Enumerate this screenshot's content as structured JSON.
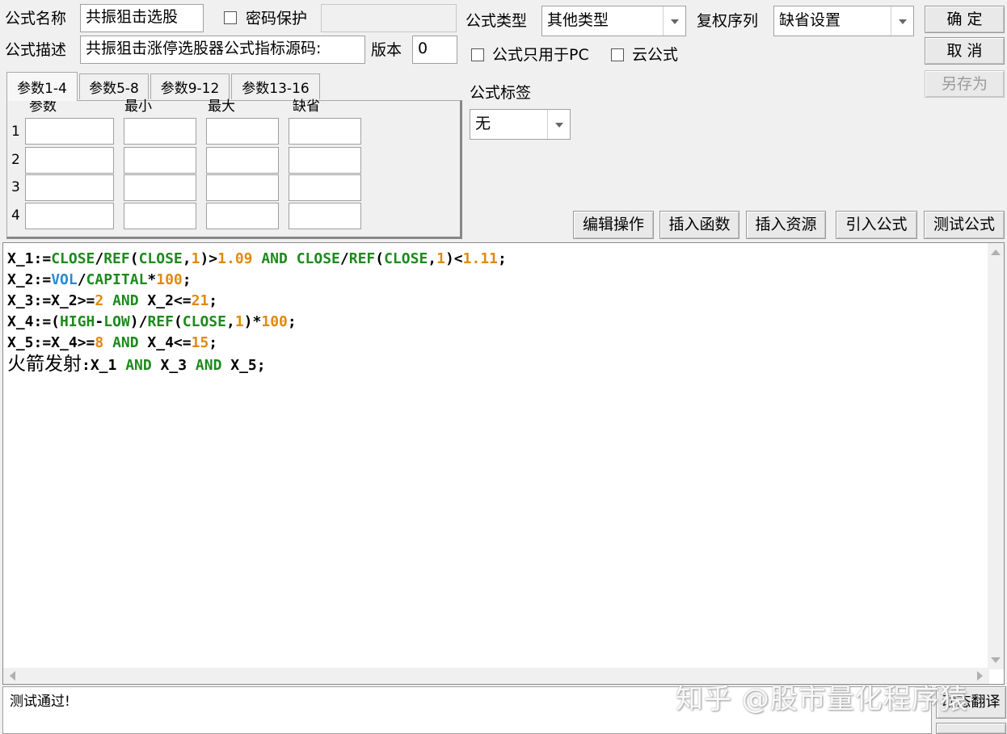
{
  "form": {
    "name_label": "公式名称",
    "name_value": "共振狙击选股",
    "password_label": "密码保护",
    "desc_label": "公式描述",
    "desc_value": "共振狙击涨停选股器公式指标源码:",
    "version_label": "版本",
    "version_value": "0",
    "type_label": "公式类型",
    "type_value": "其他类型",
    "rights_label": "复权序列",
    "rights_value": "缺省设置",
    "pc_only_label": "公式只用于PC",
    "cloud_label": "云公式",
    "tag_label": "公式标签",
    "tag_value": "无"
  },
  "buttons": {
    "confirm": "确 定",
    "cancel": "取 消",
    "save_as": "另存为",
    "edit_ops": "编辑操作",
    "insert_func": "插入函数",
    "insert_res": "插入资源",
    "import_formula": "引入公式",
    "test_formula": "测试公式",
    "dynamic_translate": "动态翻译"
  },
  "tabs": [
    "参数1-4",
    "参数5-8",
    "参数9-12",
    "参数13-16"
  ],
  "param_headers": [
    "参数",
    "最小",
    "最大",
    "缺省"
  ],
  "param_rows": [
    "1",
    "2",
    "3",
    "4"
  ],
  "code_lines": [
    [
      {
        "t": "X_1:=",
        "c": ""
      },
      {
        "t": "CLOSE",
        "c": "kw"
      },
      {
        "t": "/",
        "c": ""
      },
      {
        "t": "REF",
        "c": "kw"
      },
      {
        "t": "(",
        "c": ""
      },
      {
        "t": "CLOSE",
        "c": "kw"
      },
      {
        "t": ",",
        "c": ""
      },
      {
        "t": "1",
        "c": "num"
      },
      {
        "t": ")>",
        "c": ""
      },
      {
        "t": "1.09",
        "c": "num"
      },
      {
        "t": " ",
        "c": ""
      },
      {
        "t": "AND",
        "c": "kw"
      },
      {
        "t": " ",
        "c": ""
      },
      {
        "t": "CLOSE",
        "c": "kw"
      },
      {
        "t": "/",
        "c": ""
      },
      {
        "t": "REF",
        "c": "kw"
      },
      {
        "t": "(",
        "c": ""
      },
      {
        "t": "CLOSE",
        "c": "kw"
      },
      {
        "t": ",",
        "c": ""
      },
      {
        "t": "1",
        "c": "num"
      },
      {
        "t": ")<",
        "c": ""
      },
      {
        "t": "1.11",
        "c": "num"
      },
      {
        "t": ";",
        "c": ""
      }
    ],
    [
      {
        "t": "X_2:=",
        "c": ""
      },
      {
        "t": "VOL",
        "c": "var"
      },
      {
        "t": "/",
        "c": ""
      },
      {
        "t": "CAPITAL",
        "c": "kw"
      },
      {
        "t": "*",
        "c": ""
      },
      {
        "t": "100",
        "c": "num"
      },
      {
        "t": ";",
        "c": ""
      }
    ],
    [
      {
        "t": "X_3:=X_2>=",
        "c": ""
      },
      {
        "t": "2",
        "c": "num"
      },
      {
        "t": " ",
        "c": ""
      },
      {
        "t": "AND",
        "c": "kw"
      },
      {
        "t": " X_2<=",
        "c": ""
      },
      {
        "t": "21",
        "c": "num"
      },
      {
        "t": ";",
        "c": ""
      }
    ],
    [
      {
        "t": "X_4:=(",
        "c": ""
      },
      {
        "t": "HIGH",
        "c": "kw"
      },
      {
        "t": "-",
        "c": ""
      },
      {
        "t": "LOW",
        "c": "kw"
      },
      {
        "t": ")/",
        "c": ""
      },
      {
        "t": "REF",
        "c": "kw"
      },
      {
        "t": "(",
        "c": ""
      },
      {
        "t": "CLOSE",
        "c": "kw"
      },
      {
        "t": ",",
        "c": ""
      },
      {
        "t": "1",
        "c": "num"
      },
      {
        "t": ")*",
        "c": ""
      },
      {
        "t": "100",
        "c": "num"
      },
      {
        "t": ";",
        "c": ""
      }
    ],
    [
      {
        "t": "X_5:=X_4>=",
        "c": ""
      },
      {
        "t": "8",
        "c": "num"
      },
      {
        "t": " ",
        "c": ""
      },
      {
        "t": "AND",
        "c": "kw"
      },
      {
        "t": " X_4<=",
        "c": ""
      },
      {
        "t": "15",
        "c": "num"
      },
      {
        "t": ";",
        "c": ""
      }
    ],
    [
      {
        "t": "火箭发射",
        "c": "cjk"
      },
      {
        "t": ":X_1 ",
        "c": ""
      },
      {
        "t": "AND",
        "c": "kw"
      },
      {
        "t": " X_3 ",
        "c": ""
      },
      {
        "t": "AND",
        "c": "kw"
      },
      {
        "t": " X_5;",
        "c": ""
      }
    ]
  ],
  "status_text": "测试通过!",
  "watermark": "知乎 @股市量化程序猿"
}
